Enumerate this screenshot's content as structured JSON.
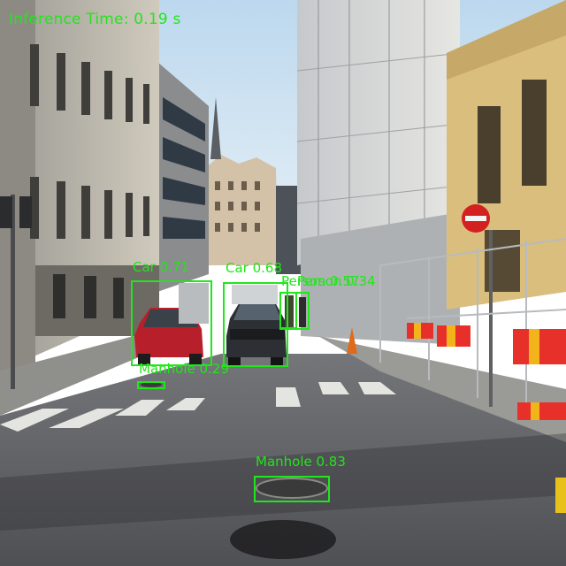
{
  "overlay": {
    "inference_time": "Inference Time: 0.19 s",
    "color": "#22e51c"
  },
  "detections": [
    {
      "label": "Car 0.71"
    },
    {
      "label": "Car 0.68"
    },
    {
      "label": "Person 0.57"
    },
    {
      "label": "Person 0.34"
    },
    {
      "label": "Manhole 0.29"
    },
    {
      "label": "Manhole 0.83"
    }
  ],
  "scene": {
    "no_entry_sign_color": "#d32020",
    "barrier_colors": [
      "#e8302a",
      "#f2b31b"
    ]
  }
}
